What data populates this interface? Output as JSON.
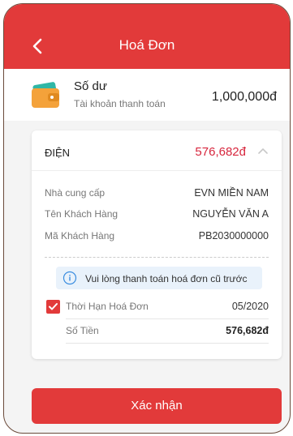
{
  "header": {
    "title": "Hoá Đơn",
    "back_icon": "chevron-left-icon",
    "color": "#e23a3a"
  },
  "balance": {
    "title": "Số dư",
    "subtitle": "Tài khoản thanh toán",
    "amount": "1,000,000đ",
    "icon": "wallet-icon"
  },
  "bill": {
    "category": "ĐIỆN",
    "amount": "576,682đ",
    "expand_icon": "chevron-up-icon",
    "details": [
      {
        "label": "Nhà cung cấp",
        "value": "EVN MIỀN NAM"
      },
      {
        "label": "Tên Khách Hàng",
        "value": "NGUYỄN VĂN A"
      },
      {
        "label": "Mã Khách Hàng",
        "value": "PB2030000000"
      }
    ],
    "notice": "Vui lòng thanh toán hoá đơn cũ trước",
    "invoice": {
      "checked": true,
      "period_label": "Thời Hạn Hoá Đơn",
      "period_value": "05/2020",
      "amount_label": "Số Tiền",
      "amount_value": "576,682đ"
    }
  },
  "confirm_label": "Xác nhận",
  "colors": {
    "accent": "#e23a3a",
    "amount_red": "#d7263d",
    "notice_bg": "#e9f2fb"
  }
}
